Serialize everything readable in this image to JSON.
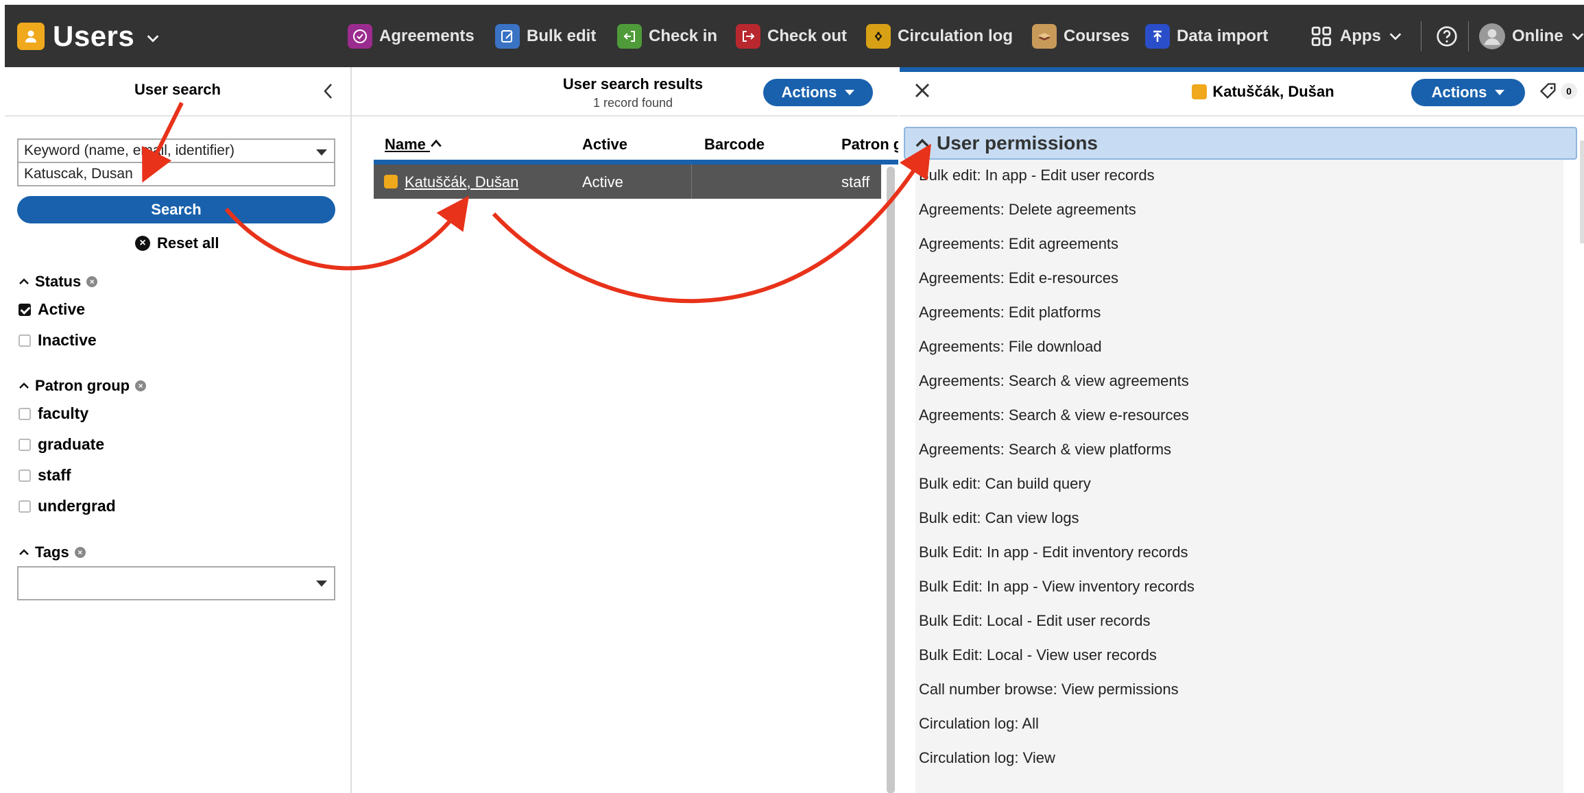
{
  "app": {
    "title": "Users"
  },
  "nav": {
    "items": [
      {
        "label": "Agreements",
        "color": "#9b2c8f"
      },
      {
        "label": "Bulk edit",
        "color": "#3a73c4"
      },
      {
        "label": "Check in",
        "color": "#4f9b3a"
      },
      {
        "label": "Check out",
        "color": "#b8282e"
      },
      {
        "label": "Circulation log",
        "color": "#d8a015"
      },
      {
        "label": "Courses",
        "color": "#c89a59"
      },
      {
        "label": "Data import",
        "color": "#2a4ec9"
      }
    ],
    "apps_label": "Apps",
    "user_label": "Online"
  },
  "search_pane": {
    "title": "User search",
    "qindex": "Keyword (name, email, identifier)",
    "query": "Katuscak, Dusan",
    "search_label": "Search",
    "reset_label": "Reset all",
    "status": {
      "title": "Status",
      "options": [
        {
          "label": "Active",
          "checked": true
        },
        {
          "label": "Inactive",
          "checked": false
        }
      ]
    },
    "patron_group": {
      "title": "Patron group",
      "options": [
        {
          "label": "faculty"
        },
        {
          "label": "graduate"
        },
        {
          "label": "staff"
        },
        {
          "label": "undergrad"
        }
      ]
    },
    "tags": {
      "title": "Tags"
    }
  },
  "results": {
    "title": "User search results",
    "count": "1 record found",
    "actions_label": "Actions",
    "columns": [
      "Name",
      "Active",
      "Barcode",
      "Patron g"
    ],
    "rows": [
      {
        "name": "Katuščák, Dušan",
        "active": "Active",
        "barcode": "",
        "patron": "staff"
      }
    ]
  },
  "detail": {
    "name": "Katuščák, Dušan",
    "actions_label": "Actions",
    "tag_count": "0",
    "section_title": "User permissions",
    "permissions": [
      "Bulk edit: In app - Edit user records",
      "Agreements: Delete agreements",
      "Agreements: Edit agreements",
      "Agreements: Edit e-resources",
      "Agreements: Edit platforms",
      "Agreements: File download",
      "Agreements: Search & view agreements",
      "Agreements: Search & view e-resources",
      "Agreements: Search & view platforms",
      "Bulk edit: Can build query",
      "Bulk edit: Can view logs",
      "Bulk Edit: In app - Edit inventory records",
      "Bulk Edit: In app - View inventory records",
      "Bulk Edit: Local - Edit user records",
      "Bulk Edit: Local - View user records",
      "Call number browse: View permissions",
      "Circulation log: All",
      "Circulation log: View"
    ]
  }
}
